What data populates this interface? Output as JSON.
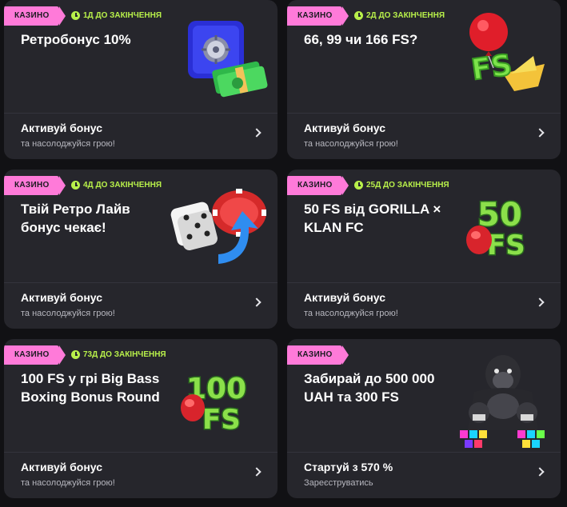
{
  "cards": [
    {
      "badge": "КАЗИНО",
      "timer": "1Д ДО ЗАКІНЧЕННЯ",
      "title": "Ретробонус 10%",
      "cta": "Активуй бонус",
      "sub": "та насолоджуйся грою!",
      "art_icon": "safe-with-cash-icon"
    },
    {
      "badge": "КАЗИНО",
      "timer": "2Д ДО ЗАКІНЧЕННЯ",
      "title": "66, 99 чи 166 FS?",
      "cta": "Активуй бонус",
      "sub": "та насолоджуйся грою!",
      "art_icon": "balloon-fs-boat-icon",
      "art_text": "FS"
    },
    {
      "badge": "КАЗИНО",
      "timer": "4Д ДО ЗАКІНЧЕННЯ",
      "title": "Твій Ретро Лайв бонус чекає!",
      "cta": "Активуй бонус",
      "sub": "та насолоджуйся грою!",
      "art_icon": "dice-chip-arrow-icon"
    },
    {
      "badge": "КАЗИНО",
      "timer": "25Д ДО ЗАКІНЧЕННЯ",
      "title": "50 FS від GORILLA × KLAN FC",
      "cta": "Активуй бонус",
      "sub": "та насолоджуйся грою!",
      "art_icon": "50-fs-boxing-glove-icon",
      "art_text_top": "50",
      "art_text_bottom": "FS"
    },
    {
      "badge": "КАЗИНО",
      "timer": "73Д ДО ЗАКІНЧЕННЯ",
      "title": "100 FS у грі Big Bass Boxing Bonus Round",
      "cta": "Активуй бонус",
      "sub": "та насолоджуйся грою!",
      "art_icon": "100-fs-boxing-glove-icon",
      "art_text_top": "100",
      "art_text_bottom": "FS"
    },
    {
      "badge": "КАЗИНО",
      "title": "Забирай до 500 000 UAH та 300 FS",
      "cta": "Стартуй з 570 %",
      "sub": "Зареєструватись",
      "art_icon": "gorilla-boxer-icon"
    }
  ],
  "colors": {
    "page_bg": "#111114",
    "card_bg": "#26262c",
    "badge_bg": "#ff7ad9",
    "timer": "#b8f04a"
  }
}
